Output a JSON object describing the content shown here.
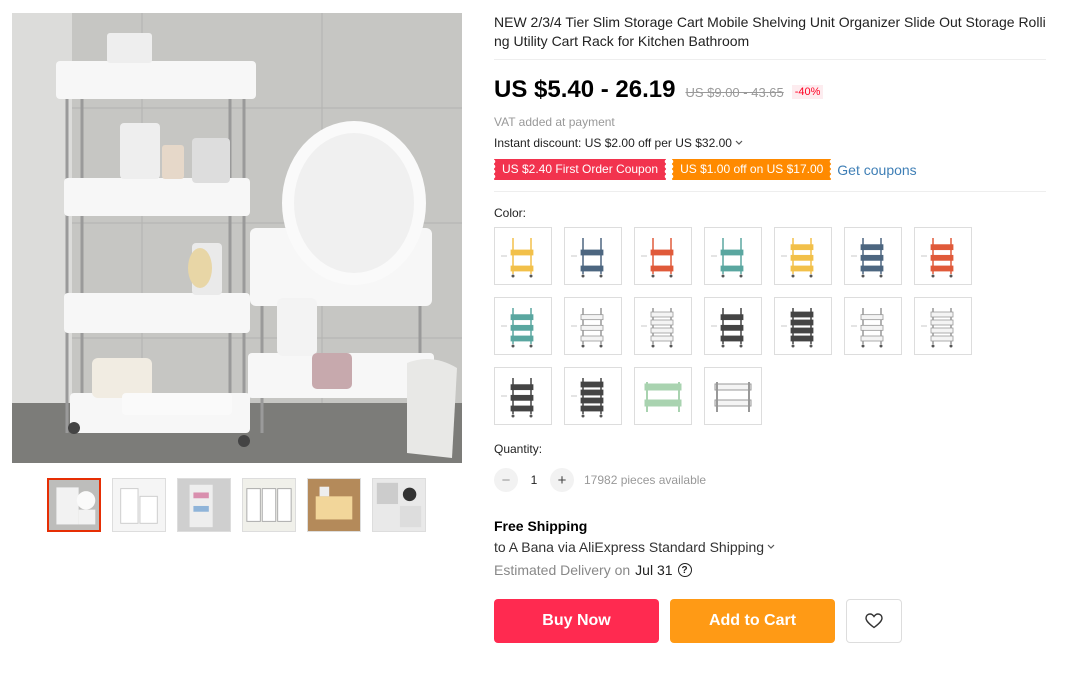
{
  "product": {
    "title": "NEW 2/3/4 Tier Slim Storage Cart Mobile Shelving Unit Organizer Slide Out Storage Rolling Utility Cart Rack for Kitchen Bathroom",
    "price": "US $5.40 - 26.19",
    "original_price": "US $9.00 - 43.65",
    "discount": "-40%",
    "vat_note": "VAT added at payment",
    "instant_discount": "Instant discount: US $2.00 off per US $32.00"
  },
  "coupons": [
    {
      "label": "US $2.40 First Order Coupon",
      "color": "#f2334e"
    },
    {
      "label": "US $1.00 off on US $17.00",
      "color": "#ff8a00"
    }
  ],
  "get_coupons_label": "Get coupons",
  "sku": {
    "label": "Color:",
    "options": [
      {
        "color": "#f2c04a",
        "icon": "yellow-cart-2tier"
      },
      {
        "color": "#4d6680",
        "icon": "blue-cart-2tier"
      },
      {
        "color": "#e05a3a",
        "icon": "red-cart-2tier"
      },
      {
        "color": "#5aa7a0",
        "icon": "teal-cart-2tier"
      },
      {
        "color": "#f2c04a",
        "icon": "yellow-cart-3tier"
      },
      {
        "color": "#4d6680",
        "icon": "blue-cart-3tier"
      },
      {
        "color": "#e05a3a",
        "icon": "red-cart-3tier"
      },
      {
        "color": "#5aa7a0",
        "icon": "teal-cart-3tier"
      },
      {
        "color": "#f4f4f4",
        "icon": "white-cart-3tier"
      },
      {
        "color": "#f4f4f4",
        "icon": "white-cart-4tier"
      },
      {
        "color": "#444444",
        "icon": "black-cart-3tier"
      },
      {
        "color": "#444444",
        "icon": "black-cart-4tier"
      },
      {
        "color": "#f4f4f4",
        "icon": "white-cart-3tier"
      },
      {
        "color": "#f4f4f4",
        "icon": "white-cart-4tier"
      },
      {
        "color": "#444444",
        "icon": "black-cart-3tier"
      },
      {
        "color": "#444444",
        "icon": "black-cart-4tier"
      },
      {
        "color": "#a9d3b0",
        "icon": "green-rack"
      },
      {
        "color": "#f4f4f4",
        "icon": "white-rack"
      }
    ]
  },
  "quantity": {
    "label": "Quantity:",
    "value": "1",
    "available": "17982 pieces available",
    "minus": "−",
    "plus": "+"
  },
  "shipping": {
    "title": "Free Shipping",
    "line": "to A Bana via AliExpress Standard Shipping",
    "delivery_prefix": "Estimated Delivery on",
    "delivery_date": "Jul 31",
    "help": "?"
  },
  "actions": {
    "buy": "Buy Now",
    "cart": "Add to Cart"
  },
  "thumbnails": [
    {
      "icon": "cart-photo-1"
    },
    {
      "icon": "cart-photo-2"
    },
    {
      "icon": "cart-photo-3"
    },
    {
      "icon": "cart-photo-4"
    },
    {
      "icon": "cart-photo-5"
    },
    {
      "icon": "cart-photo-6"
    }
  ]
}
